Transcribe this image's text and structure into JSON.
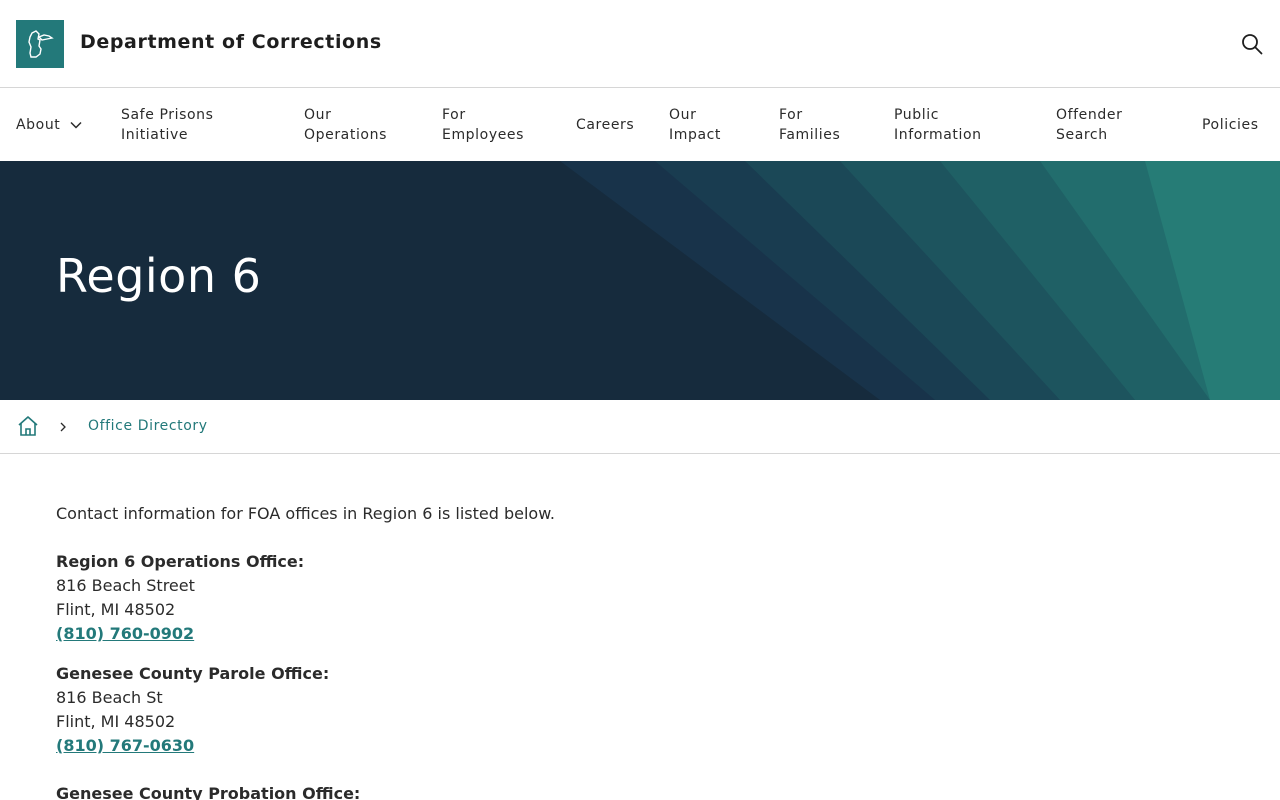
{
  "header": {
    "site_title": "Department of Corrections",
    "logo_icon": "michigan-map-icon",
    "search_icon": "search-icon"
  },
  "nav": {
    "items": [
      {
        "label": "About",
        "has_dropdown": true
      },
      {
        "label": "Safe Prisons\nInitiative"
      },
      {
        "label": "Our\nOperations"
      },
      {
        "label": "For\nEmployees"
      },
      {
        "label": "Careers"
      },
      {
        "label": "Our\nImpact"
      },
      {
        "label": "For\nFamilies"
      },
      {
        "label": "Public\nInformation"
      },
      {
        "label": "Offender\nSearch"
      },
      {
        "label": "Policies"
      }
    ]
  },
  "hero": {
    "title": "Region 6"
  },
  "breadcrumb": {
    "home_icon": "home-icon",
    "separator_icon": "chevron-right-icon",
    "current": "Office Directory"
  },
  "content": {
    "intro": "Contact information for FOA offices in Region 6 is listed below.",
    "offices": [
      {
        "name": "Region 6 Operations Office:",
        "street": "816 Beach Street",
        "city": "Flint, MI 48502",
        "phone": "(810) 760-0902"
      },
      {
        "name": "Genesee County Parole Office:",
        "street": "816 Beach St",
        "city": "Flint, MI 48502",
        "phone": "(810) 767-0630"
      },
      {
        "name": "Genesee County Probation Office:"
      }
    ]
  },
  "colors": {
    "accent": "#23797a",
    "hero_bg": "#162b3d",
    "text": "#2b2b2b"
  }
}
